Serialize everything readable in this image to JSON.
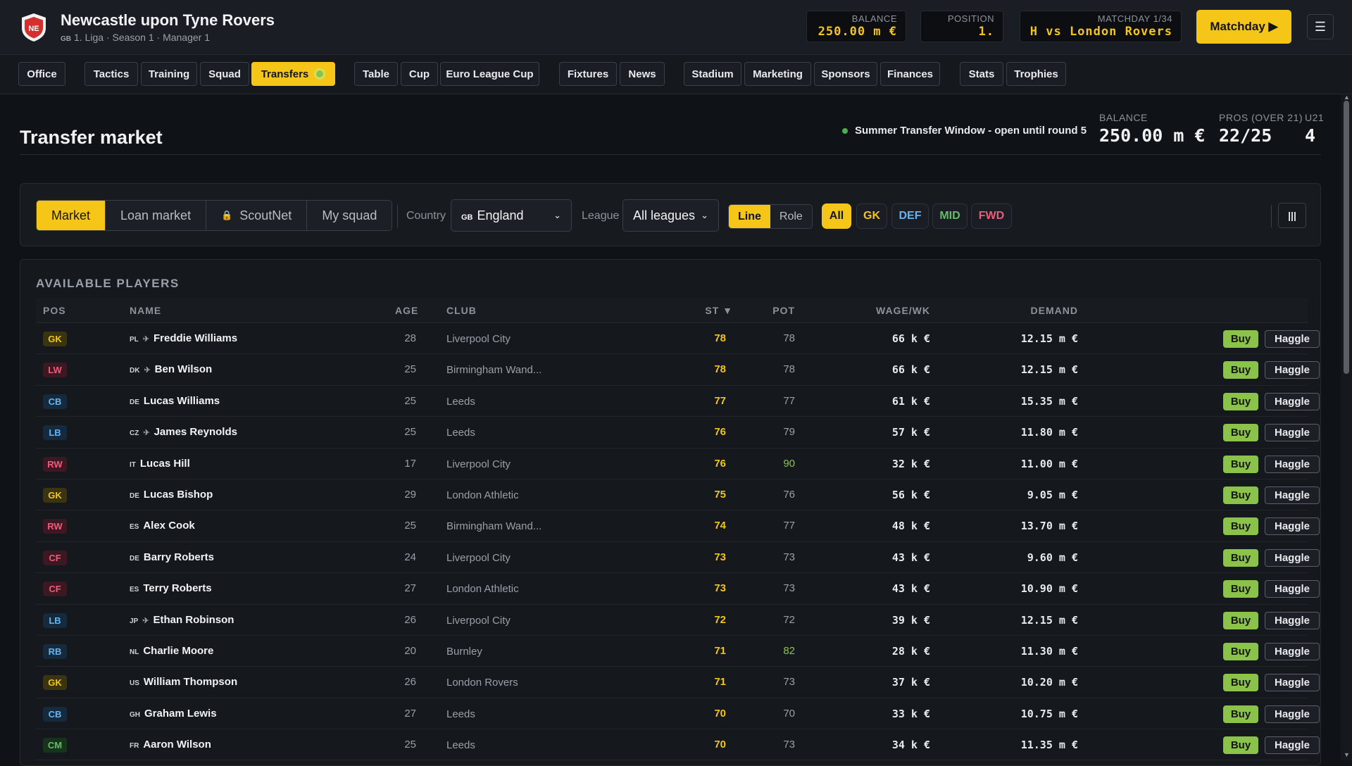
{
  "header": {
    "club_name": "Newcastle upon Tyne Rovers",
    "crest_text": "NE",
    "country_code": "GB",
    "subtitle": "1. Liga · Season 1 · Manager 1",
    "balance_label": "BALANCE",
    "balance_value": "250.00 m €",
    "position_label": "POSITION",
    "position_value": "1.",
    "matchday_label": "MATCHDAY 1/34",
    "matchday_value": "H vs London Rovers",
    "matchday_button": "Matchday ▶",
    "menu_icon": "☰"
  },
  "nav": {
    "tabs": [
      "Office",
      "Tactics",
      "Training",
      "Squad",
      "Transfers",
      "Table",
      "Cup",
      "Euro League Cup",
      "Fixtures",
      "News",
      "Stadium",
      "Marketing",
      "Sponsors",
      "Finances",
      "Stats",
      "Trophies"
    ],
    "active": "Transfers"
  },
  "page": {
    "title": "Transfer market",
    "window_note": "Summer Transfer Window - open until round 5",
    "balance_label": "BALANCE",
    "balance_value": "250.00 m €",
    "pros_label": "PROS (OVER 21)",
    "pros_value": "22/25",
    "u21_label": "U21",
    "u21_value": "4"
  },
  "filters": {
    "segments": [
      "Market",
      "Loan market",
      "ScoutNet",
      "My squad"
    ],
    "active_segment": "Market",
    "country_label": "Country",
    "country_flag": "GB",
    "country_value": "England",
    "league_label": "League",
    "league_value": "All leagues",
    "view_toggle": [
      "Line",
      "Role"
    ],
    "active_view": "Line",
    "positions": [
      "All",
      "GK",
      "DEF",
      "MID",
      "FWD"
    ],
    "active_position": "All",
    "columns_icon": "|||"
  },
  "players": {
    "title": "AVAILABLE PLAYERS",
    "columns": {
      "pos": "POS",
      "name": "NAME",
      "age": "AGE",
      "club": "CLUB",
      "st": "ST ▼",
      "pot": "POT",
      "wage": "WAGE/WK",
      "demand": "DEMAND"
    },
    "buy_label": "Buy",
    "haggle_label": "Haggle",
    "rows": [
      {
        "pos": "GK",
        "flag": "PL",
        "foreign": true,
        "name": "Freddie Williams",
        "age": "28",
        "club": "Liverpool City",
        "st": "78",
        "pot": "78",
        "wage": "66 k €",
        "demand": "12.15 m €"
      },
      {
        "pos": "LW",
        "flag": "DK",
        "foreign": true,
        "name": "Ben Wilson",
        "age": "25",
        "club": "Birmingham Wand...",
        "st": "78",
        "pot": "78",
        "wage": "66 k €",
        "demand": "12.15 m €"
      },
      {
        "pos": "CB",
        "flag": "DE",
        "foreign": false,
        "name": "Lucas Williams",
        "age": "25",
        "club": "Leeds",
        "st": "77",
        "pot": "77",
        "wage": "61 k €",
        "demand": "15.35 m €"
      },
      {
        "pos": "LB",
        "flag": "CZ",
        "foreign": true,
        "name": "James Reynolds",
        "age": "25",
        "club": "Leeds",
        "st": "76",
        "pot": "79",
        "wage": "57 k €",
        "demand": "11.80 m €"
      },
      {
        "pos": "RW",
        "flag": "IT",
        "foreign": false,
        "name": "Lucas Hill",
        "age": "17",
        "club": "Liverpool City",
        "st": "76",
        "pot": "90",
        "wage": "32 k €",
        "demand": "11.00 m €",
        "pot_high": true
      },
      {
        "pos": "GK",
        "flag": "DE",
        "foreign": false,
        "name": "Lucas Bishop",
        "age": "29",
        "club": "London Athletic",
        "st": "75",
        "pot": "76",
        "wage": "56 k €",
        "demand": "9.05 m €"
      },
      {
        "pos": "RW",
        "flag": "ES",
        "foreign": false,
        "name": "Alex Cook",
        "age": "25",
        "club": "Birmingham Wand...",
        "st": "74",
        "pot": "77",
        "wage": "48 k €",
        "demand": "13.70 m €"
      },
      {
        "pos": "CF",
        "flag": "DE",
        "foreign": false,
        "name": "Barry Roberts",
        "age": "24",
        "club": "Liverpool City",
        "st": "73",
        "pot": "73",
        "wage": "43 k €",
        "demand": "9.60 m €"
      },
      {
        "pos": "CF",
        "flag": "ES",
        "foreign": false,
        "name": "Terry Roberts",
        "age": "27",
        "club": "London Athletic",
        "st": "73",
        "pot": "73",
        "wage": "43 k €",
        "demand": "10.90 m €"
      },
      {
        "pos": "LB",
        "flag": "JP",
        "foreign": true,
        "name": "Ethan Robinson",
        "age": "26",
        "club": "Liverpool City",
        "st": "72",
        "pot": "72",
        "wage": "39 k €",
        "demand": "12.15 m €"
      },
      {
        "pos": "RB",
        "flag": "NL",
        "foreign": false,
        "name": "Charlie Moore",
        "age": "20",
        "club": "Burnley",
        "st": "71",
        "pot": "82",
        "wage": "28 k €",
        "demand": "11.30 m €",
        "pot_high": true
      },
      {
        "pos": "GK",
        "flag": "US",
        "foreign": false,
        "name": "William Thompson",
        "age": "26",
        "club": "London Rovers",
        "st": "71",
        "pot": "73",
        "wage": "37 k €",
        "demand": "10.20 m €"
      },
      {
        "pos": "CB",
        "flag": "GH",
        "foreign": false,
        "name": "Graham Lewis",
        "age": "27",
        "club": "Leeds",
        "st": "70",
        "pot": "70",
        "wage": "33 k €",
        "demand": "10.75 m €"
      },
      {
        "pos": "CM",
        "flag": "FR",
        "foreign": false,
        "name": "Aaron Wilson",
        "age": "25",
        "club": "Leeds",
        "st": "70",
        "pot": "73",
        "wage": "34 k €",
        "demand": "11.35 m €"
      }
    ]
  },
  "colors": {
    "accent": "#f5c518",
    "buy": "#8bc34a",
    "pot_high": "#8bc34a",
    "gk": "#f5c518",
    "def": "#64b5f6",
    "mid": "#66bb6a",
    "fwd": "#ef5b7a"
  }
}
